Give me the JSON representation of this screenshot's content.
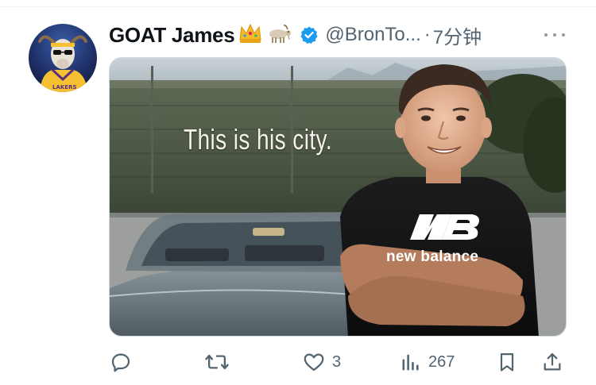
{
  "tweet": {
    "author_name": "GOAT James",
    "author_emojis": [
      "crown-emoji",
      "goat-emoji"
    ],
    "verified": true,
    "handle": "@BronTo...",
    "separator": "·",
    "time": "7分钟"
  },
  "media": {
    "caption": "This is his city.",
    "shirt_text": "new balance"
  },
  "actions": {
    "reply_count": "",
    "retweet_count": "",
    "like_count": "3",
    "views_count": "267"
  },
  "colors": {
    "text_primary": "#0f1419",
    "text_secondary": "#536471",
    "verified_blue": "#1d9bf0",
    "border": "#cfd9de"
  }
}
